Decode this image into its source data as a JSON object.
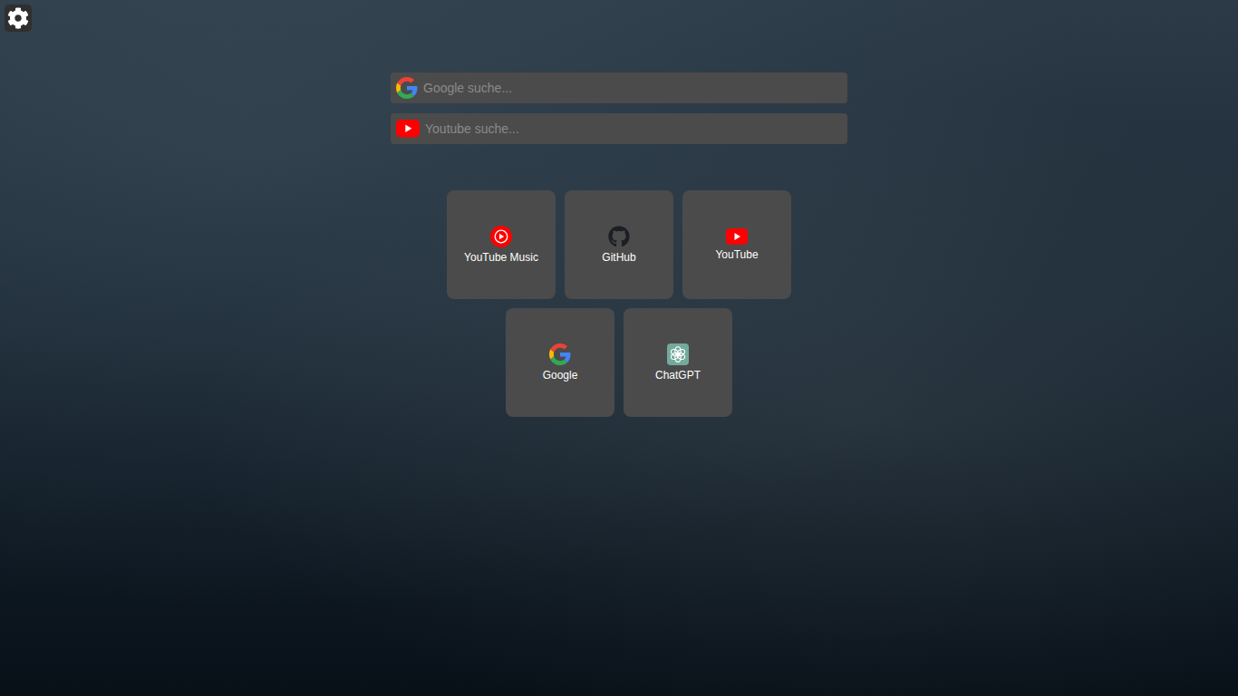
{
  "searches": [
    {
      "kind": "google",
      "placeholder": "Google suche..."
    },
    {
      "kind": "youtube",
      "placeholder": "Youtube suche..."
    }
  ],
  "shortcuts": [
    {
      "label": "YouTube Music",
      "kind": "youtube-music"
    },
    {
      "label": "GitHub",
      "kind": "github"
    },
    {
      "label": "YouTube",
      "kind": "youtube"
    },
    {
      "label": "Google",
      "kind": "google"
    },
    {
      "label": "ChatGPT",
      "kind": "chatgpt"
    }
  ]
}
